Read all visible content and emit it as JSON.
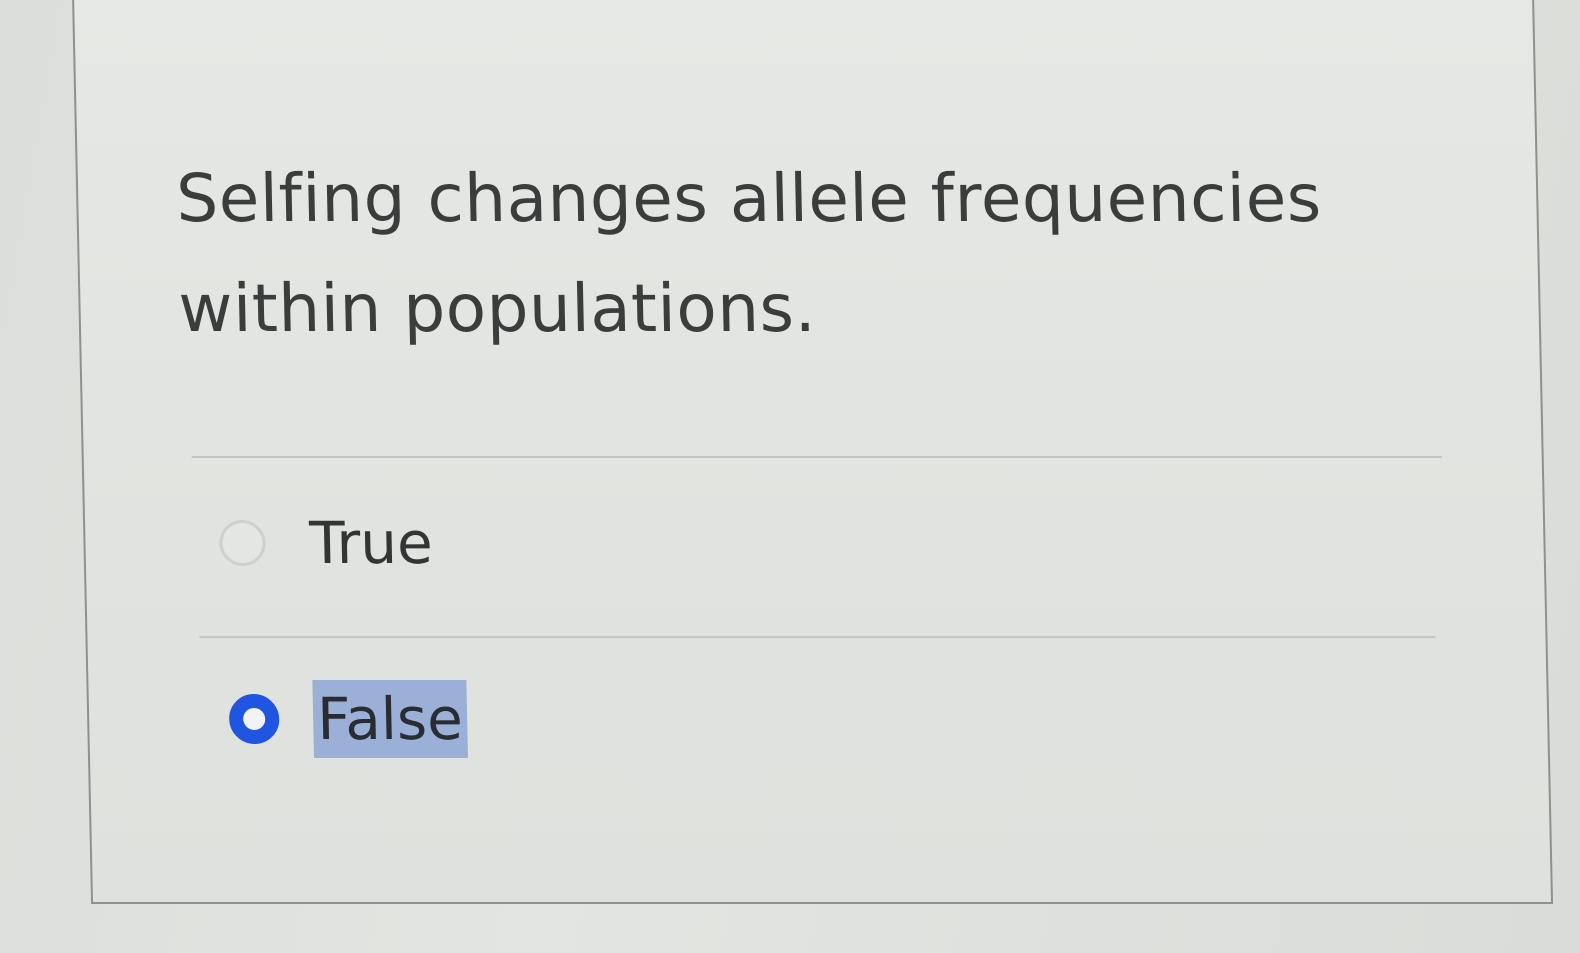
{
  "question": {
    "text": "Selfing changes allele frequencies within populations."
  },
  "options": [
    {
      "label": "True",
      "selected": false
    },
    {
      "label": "False",
      "selected": true
    }
  ],
  "colors": {
    "accent": "#1f55e0",
    "selection_highlight": "#9ab0d6"
  }
}
